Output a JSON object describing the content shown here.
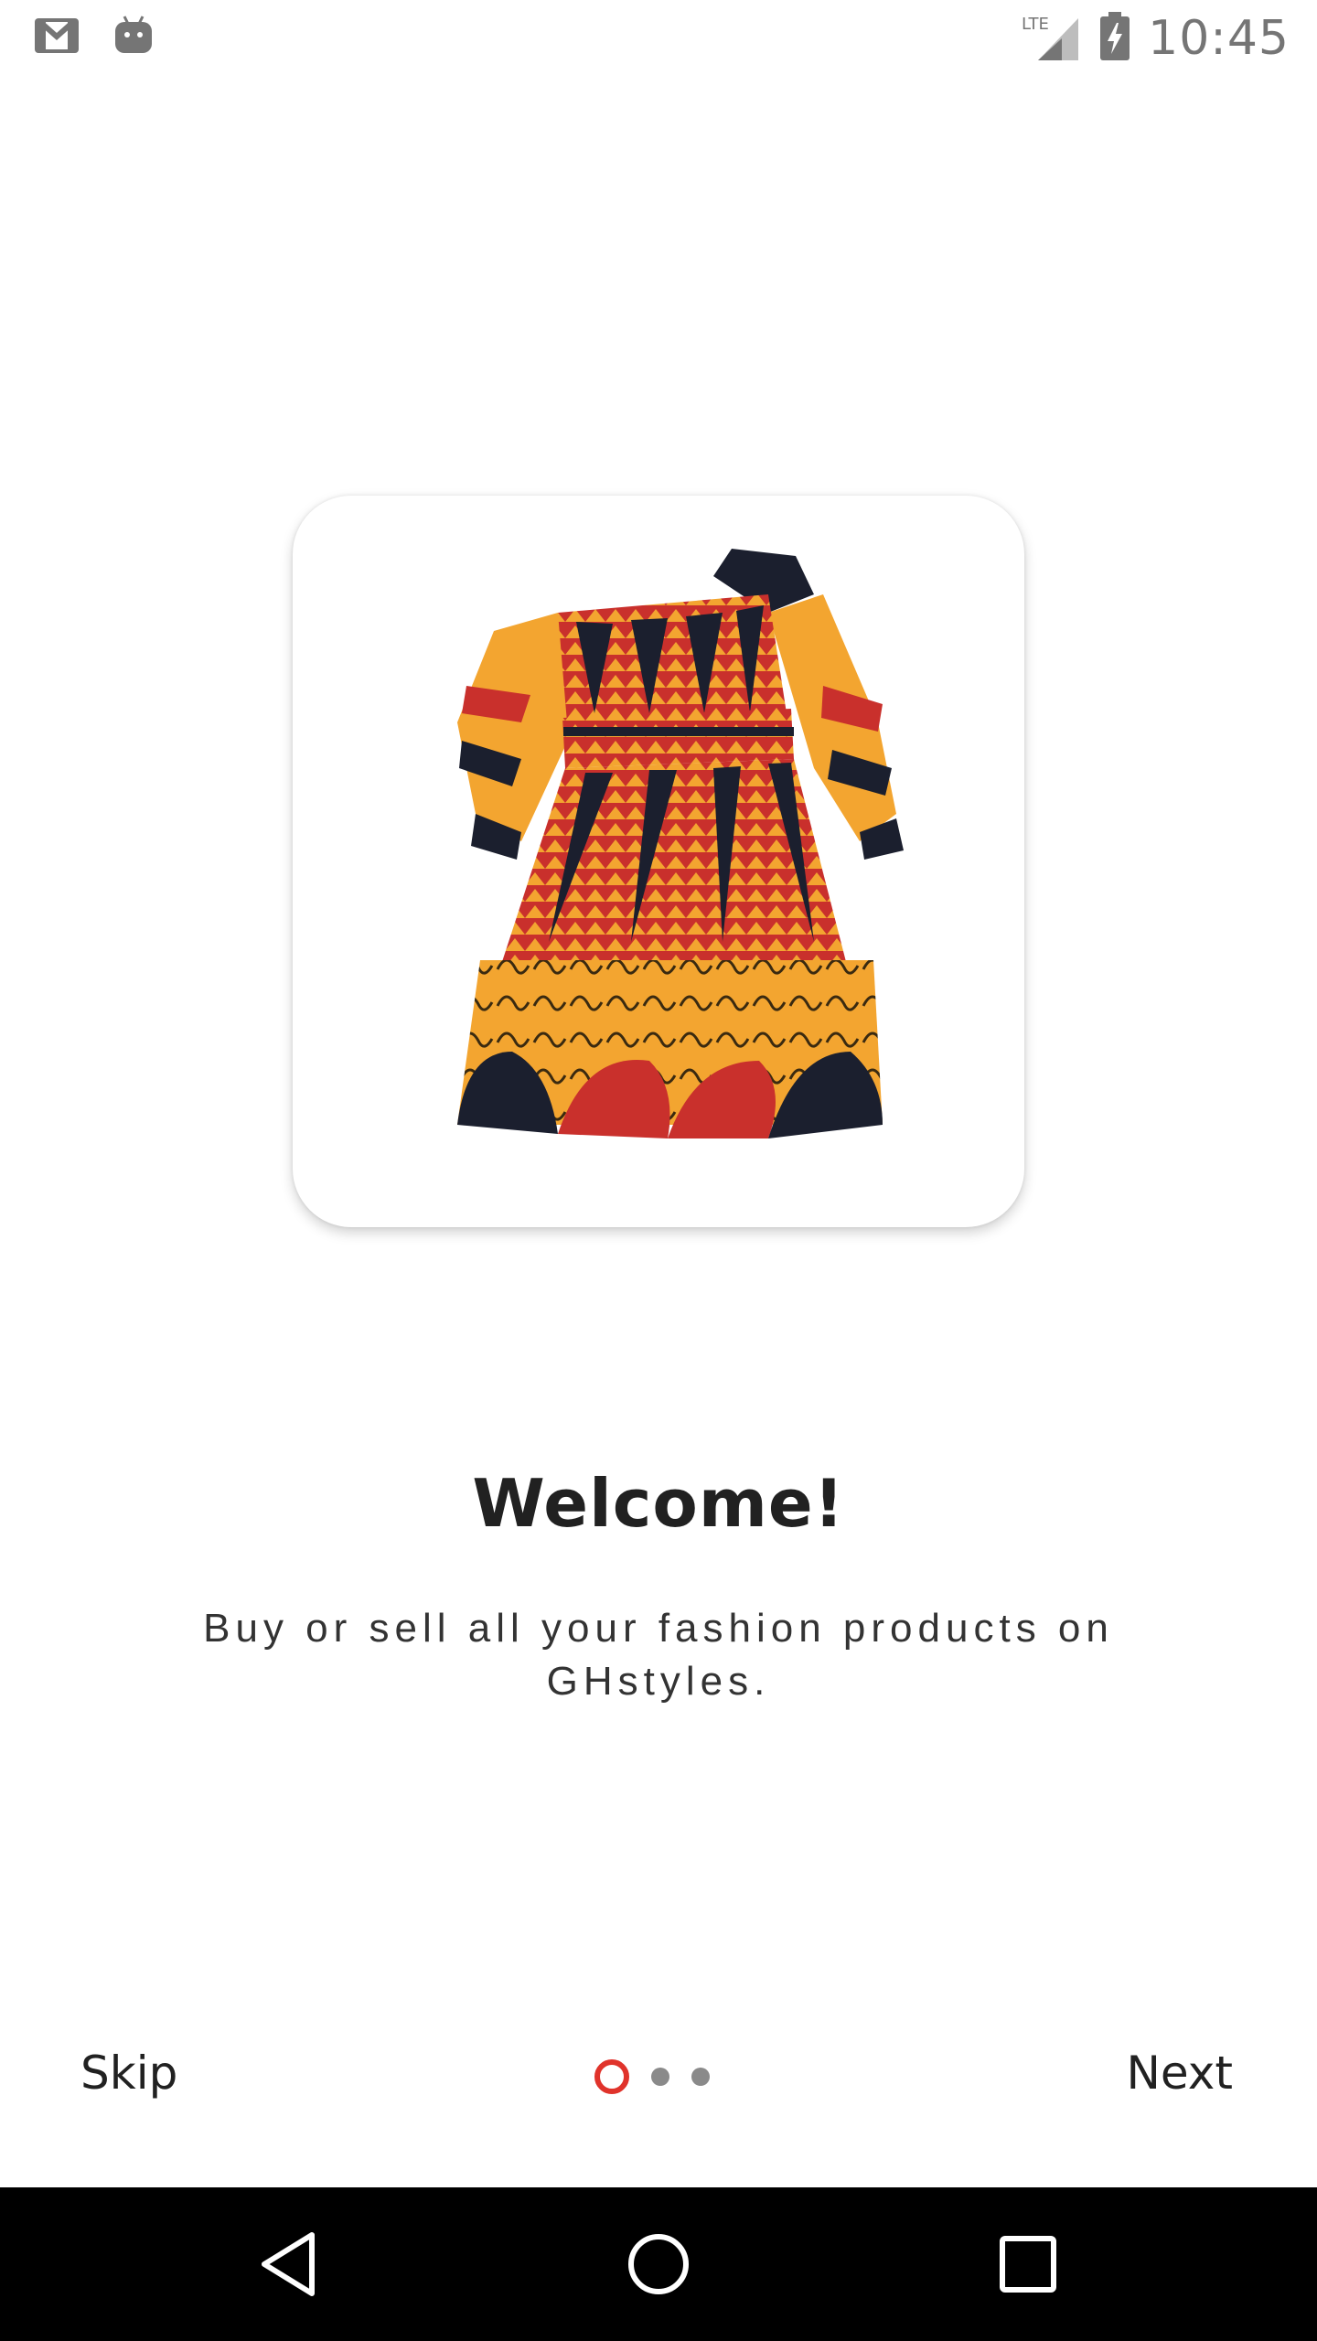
{
  "status_bar": {
    "time": "10:45",
    "network": "LTE",
    "icons": [
      "gmail-icon",
      "android-icon",
      "signal-icon",
      "battery-charging-icon"
    ]
  },
  "onboarding": {
    "image_alt": "dress-image",
    "title": "Welcome!",
    "subtitle_line1": "Buy or sell all your fashion products on",
    "subtitle_line2": "GHstyles.",
    "page_count": 3,
    "active_page": 1
  },
  "controls": {
    "skip_label": "Skip",
    "next_label": "Next"
  },
  "nav_bar": {
    "icons": [
      "back-icon",
      "home-icon",
      "recents-icon"
    ]
  },
  "colors": {
    "accent": "#e0332b",
    "dot_inactive": "#8a8a8a",
    "nav_bar": "#000000"
  }
}
